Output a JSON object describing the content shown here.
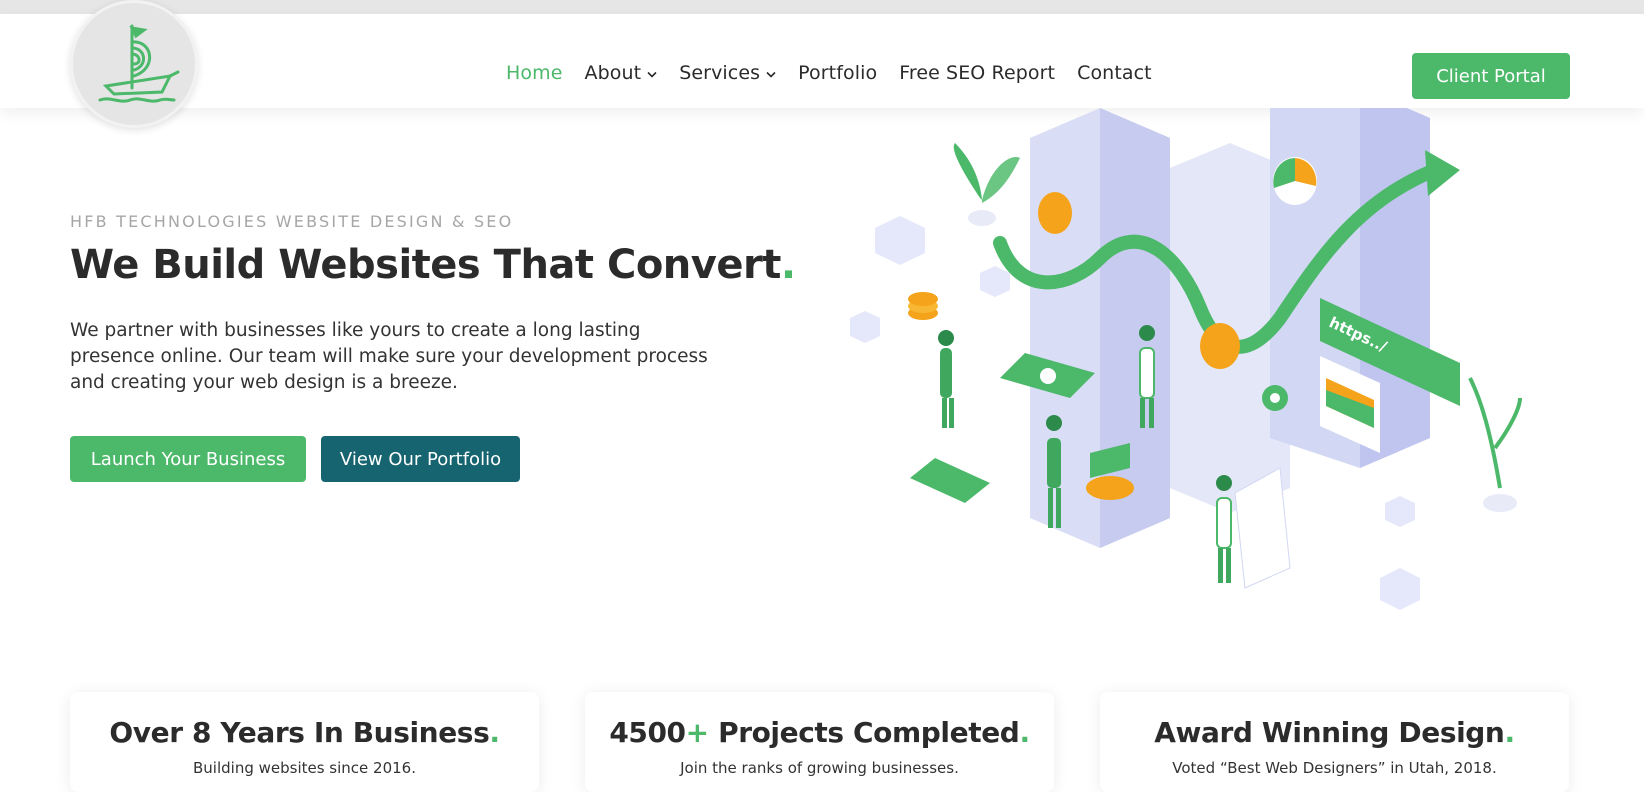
{
  "nav": {
    "items": [
      {
        "label": "Home",
        "active": true,
        "dropdown": false
      },
      {
        "label": "About",
        "active": false,
        "dropdown": true
      },
      {
        "label": "Services",
        "active": false,
        "dropdown": true
      },
      {
        "label": "Portfolio",
        "active": false,
        "dropdown": false
      },
      {
        "label": "Free SEO Report",
        "active": false,
        "dropdown": false
      },
      {
        "label": "Contact",
        "active": false,
        "dropdown": false
      }
    ],
    "portal_label": "Client Portal"
  },
  "hero": {
    "eyebrow": "HFB TECHNOLOGIES WEBSITE DESIGN & SEO",
    "headline": "We Build Websites That Convert",
    "accent_dot": ".",
    "paragraph": "We partner with businesses like yours to create a long lasting presence online. Our team will make sure your development process and creating your web design is a breeze.",
    "primary_cta": "Launch Your Business",
    "secondary_cta": "View Our Portfolio",
    "illustration_url_text": "https../"
  },
  "stats": [
    {
      "title_prefix": "Over 8 Years In Business",
      "title_plus": "",
      "title_rest": "",
      "sub": "Building websites since 2016."
    },
    {
      "title_prefix": "4500",
      "title_plus": "+",
      "title_rest": " Projects Completed",
      "sub": "Join the ranks of growing businesses."
    },
    {
      "title_prefix": "Award Winning Design",
      "title_plus": "",
      "title_rest": "",
      "sub": "Voted “Best Web Designers” in Utah, 2018."
    }
  ],
  "colors": {
    "accent": "#4cb86a",
    "teal": "#166470",
    "text": "#2b2b2b",
    "muted": "#a6a6a6"
  },
  "icons": [
    "ship-logo-icon",
    "chevron-down-icon"
  ]
}
